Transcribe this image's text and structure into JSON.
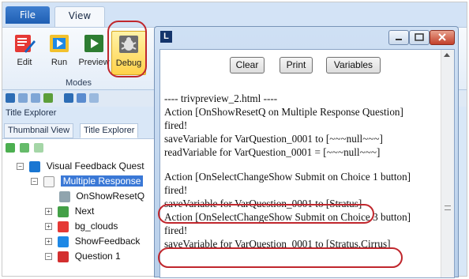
{
  "ribbon": {
    "tabs": [
      {
        "label": "File"
      },
      {
        "label": "View"
      }
    ],
    "buttons": [
      {
        "label": "Edit"
      },
      {
        "label": "Run"
      },
      {
        "label": "Preview"
      },
      {
        "label": "Debug"
      }
    ],
    "group_label": "Modes"
  },
  "explorer": {
    "header": "Title Explorer",
    "tabs": [
      {
        "label": "Thumbnail View"
      },
      {
        "label": "Title Explorer"
      }
    ],
    "tree": [
      {
        "label": "Visual Feedback Quest"
      },
      {
        "label": "Multiple Response"
      },
      {
        "label": "OnShowResetQ"
      },
      {
        "label": "Next"
      },
      {
        "label": "bg_clouds"
      },
      {
        "label": "ShowFeedback"
      },
      {
        "label": "Question 1"
      }
    ]
  },
  "popup": {
    "logo_letter": "L",
    "buttons": [
      {
        "label": "Clear"
      },
      {
        "label": "Print"
      },
      {
        "label": "Variables"
      }
    ],
    "log": [
      "---- trivpreview_2.html ----",
      "Action [OnShowResetQ on Multiple Response Question]",
      "fired!",
      "saveVariable for VarQuestion_0001 to [~~~null~~~]",
      "readVariable for VarQuestion_0001 = [~~~null~~~]",
      "",
      "Action [OnSelectChangeShow Submit on Choice 1 button]",
      "fired!",
      "saveVariable for VarQuestion_0001 to [Stratus]",
      "Action [OnSelectChangeShow Submit on Choice 3 button]",
      "fired!",
      "saveVariable for VarQuestion_0001 to [Stratus,Cirrus]"
    ]
  },
  "colors": {
    "highlight_ring": "#c0272d",
    "selection": "#3a78d6",
    "debug_active": "#ffd24a"
  },
  "icons": [
    "edit-icon",
    "run-icon",
    "preview-icon",
    "debug-icon",
    "minimize-icon",
    "maximize-icon",
    "close-icon"
  ]
}
